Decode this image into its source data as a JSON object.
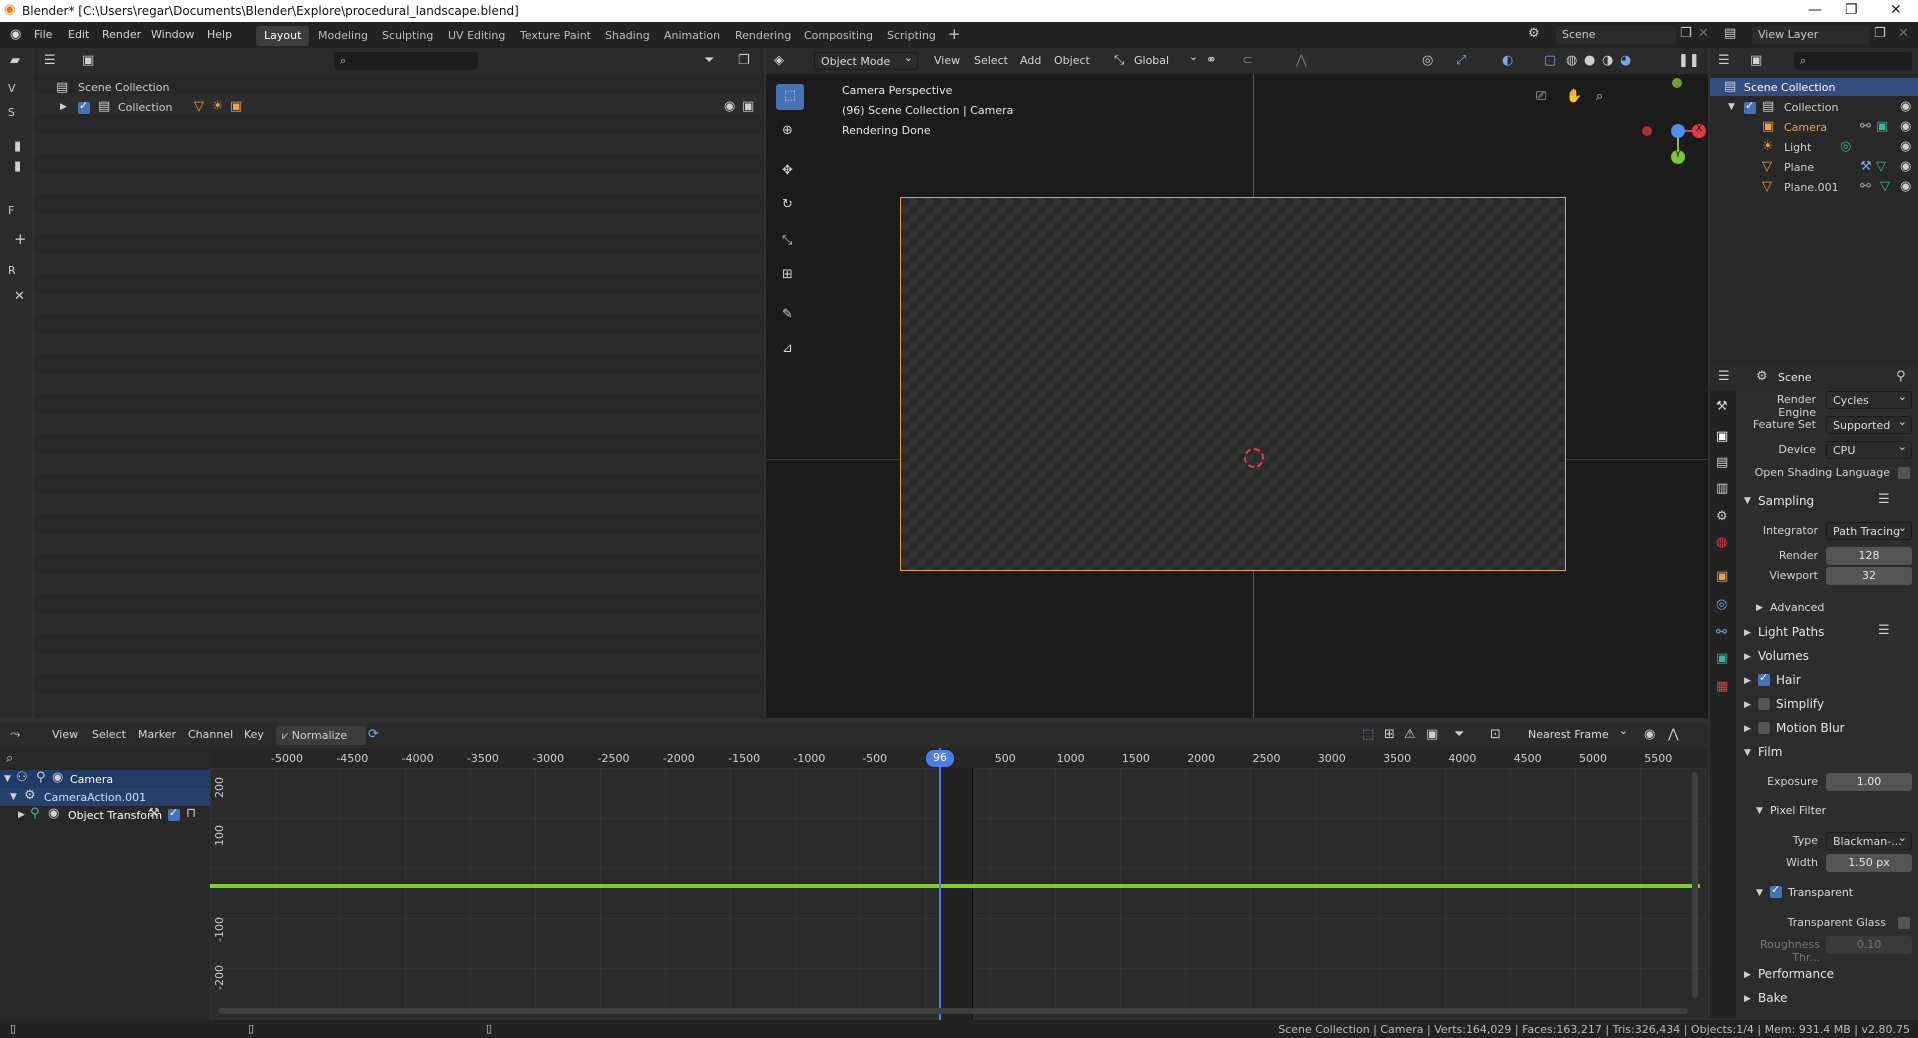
{
  "window": {
    "title": "Blender* [C:\\Users\\regar\\Documents\\Blender\\Explore\\procedural_landscape.blend]"
  },
  "menu": [
    "File",
    "Edit",
    "Render",
    "Window",
    "Help"
  ],
  "workspaces": [
    "Layout",
    "Modeling",
    "Sculpting",
    "UV Editing",
    "Texture Paint",
    "Shading",
    "Animation",
    "Rendering",
    "Compositing",
    "Scripting"
  ],
  "scene_selector": "Scene",
  "view_layer": "View Layer",
  "left_toolbar_letters": [
    "V",
    "S",
    "F",
    "R"
  ],
  "outliner_left": {
    "root": "Scene Collection",
    "collection": "Collection"
  },
  "viewport": {
    "mode": "Object Mode",
    "menus": [
      "View",
      "Select",
      "Add",
      "Object"
    ],
    "orientation": "Global",
    "info_line1": "Camera Perspective",
    "info_line2": "(96) Scene Collection | Camera",
    "info_line3": "Rendering Done",
    "gizmo_x": "X",
    "gizmo_y": "Y"
  },
  "outliner_right": {
    "root": "Scene Collection",
    "items": [
      {
        "label": "Collection",
        "color": "#cfcfcf"
      },
      {
        "label": "Camera",
        "color": "#f0a04b"
      },
      {
        "label": "Light",
        "color": "#cfcfcf"
      },
      {
        "label": "Plane",
        "color": "#cfcfcf"
      },
      {
        "label": "Plane.001",
        "color": "#cfcfcf"
      }
    ]
  },
  "properties": {
    "context": "Scene",
    "render_engine_label": "Render Engine",
    "render_engine": "Cycles",
    "feature_set_label": "Feature Set",
    "feature_set": "Supported",
    "device_label": "Device",
    "device": "CPU",
    "osl_label": "Open Shading Language",
    "sampling": "Sampling",
    "integrator_label": "Integrator",
    "integrator": "Path Tracing",
    "render_label": "Render",
    "render_value": "128",
    "viewport_label": "Viewport",
    "viewport_value": "32",
    "advanced": "Advanced",
    "light_paths": "Light Paths",
    "volumes": "Volumes",
    "hair": "Hair",
    "simplify": "Simplify",
    "motion_blur": "Motion Blur",
    "film": "Film",
    "exposure_label": "Exposure",
    "exposure_value": "1.00",
    "pixel_filter": "Pixel Filter",
    "type_label": "Type",
    "type_value": "Blackman-...",
    "width_label": "Width",
    "width_value": "1.50 px",
    "transparent": "Transparent",
    "transparent_glass": "Transparent Glass",
    "roughness_label": "Roughness Thr...",
    "roughness_value": "0.10",
    "performance": "Performance",
    "bake": "Bake"
  },
  "graph_editor": {
    "menus": [
      "View",
      "Select",
      "Marker",
      "Channel",
      "Key"
    ],
    "normalize": "Normalize",
    "snap_mode": "Nearest Frame",
    "current_frame": "96",
    "x_ticks": [
      "-5000",
      "-4500",
      "-4000",
      "-3500",
      "-3000",
      "-2500",
      "-2000",
      "-1500",
      "-1000",
      "-500",
      "500",
      "1000",
      "1500",
      "2000",
      "2500",
      "3000",
      "3500",
      "4000",
      "4500",
      "5000",
      "5500"
    ],
    "y_ticks": [
      "200",
      "100",
      "-100",
      "-200"
    ],
    "channels": {
      "object": "Camera",
      "action": "CameraAction.001",
      "group": "Object Transform"
    }
  },
  "status_bar": "Scene Collection | Camera | Verts:164,029 | Faces:163,217 | Tris:326,434 | Objects:1/4 | Mem: 931.4 MB | v2.80.75",
  "colors": {
    "accent_blue": "#4772b3",
    "camera_orange": "#f0a04b",
    "curve_green": "#7fd11f",
    "frame_line": "#4f7ee8",
    "axis_red": "#e53a4a",
    "axis_green": "#7ec33b"
  }
}
